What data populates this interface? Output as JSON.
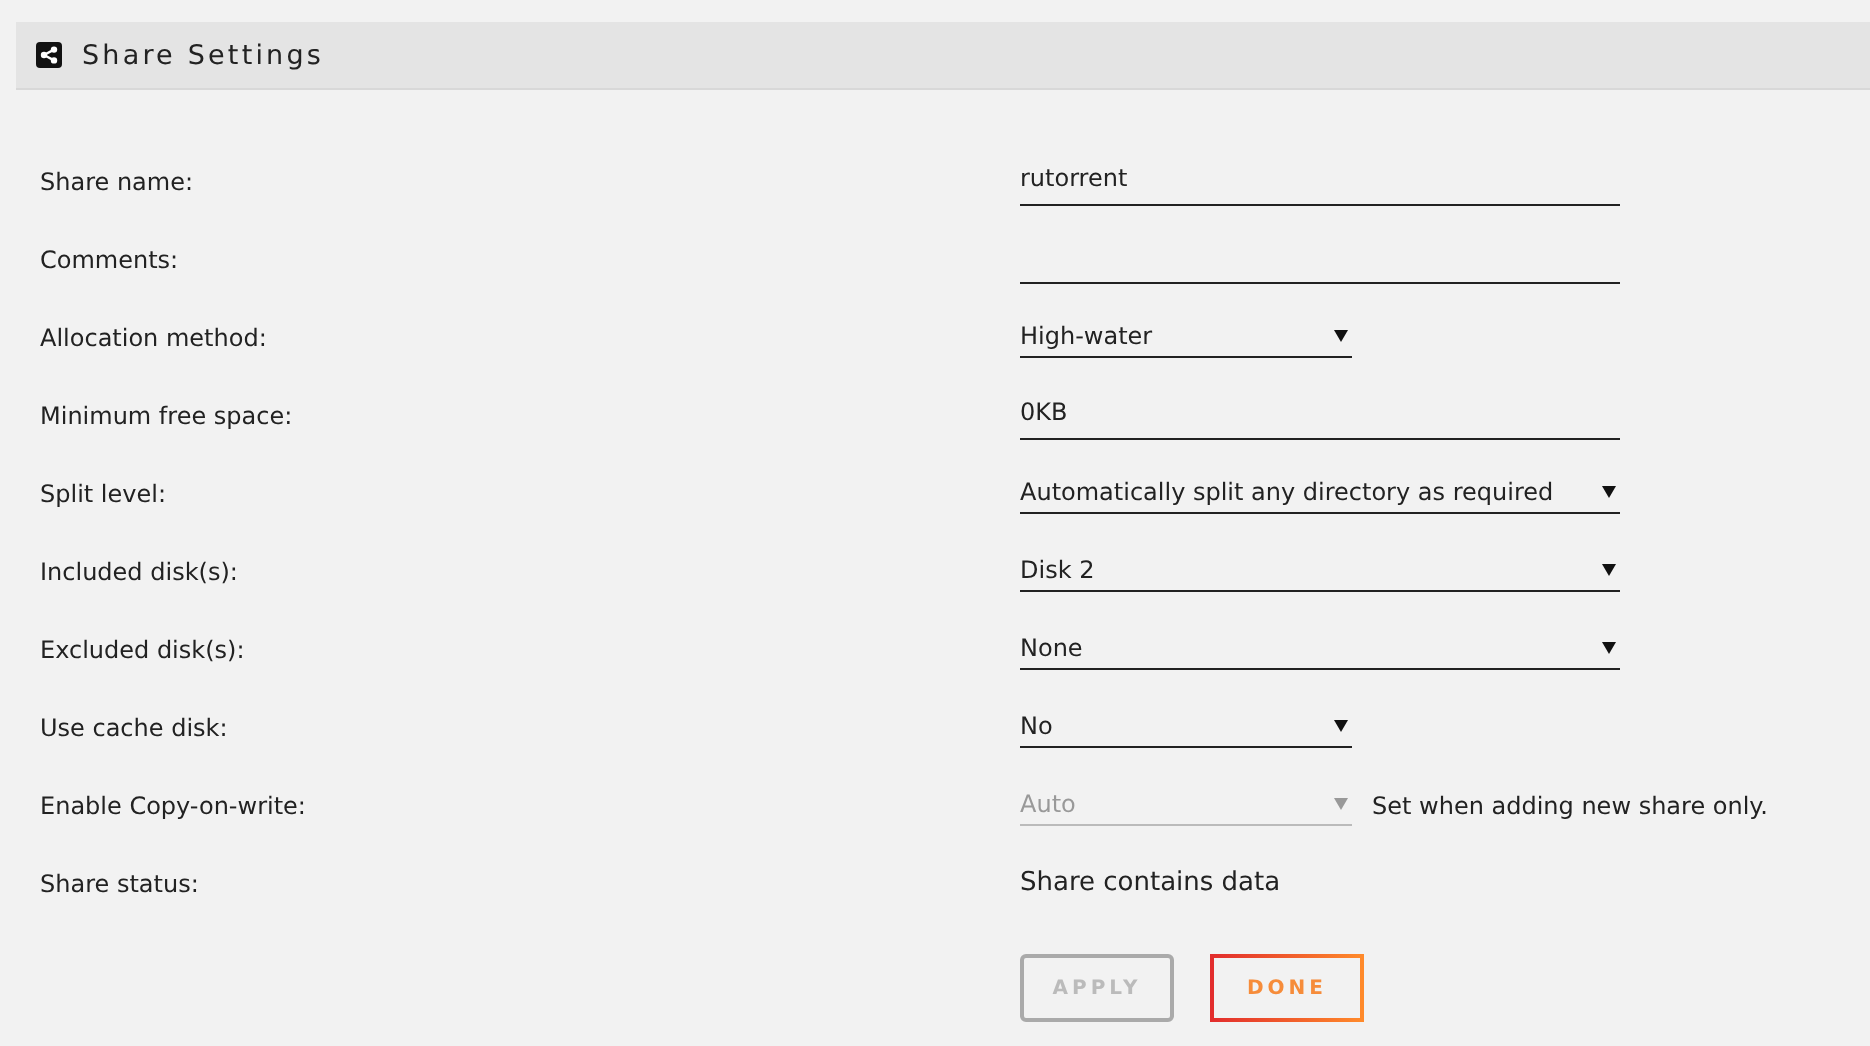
{
  "header": {
    "title": "Share Settings"
  },
  "rows": [
    {
      "label": "Share name:",
      "kind": "textbox",
      "value": "rutorrent"
    },
    {
      "label": "Comments:",
      "kind": "textbox"
    },
    {
      "label": "Allocation method:",
      "kind": "dropdown",
      "value": "High-water",
      "disabled": false
    },
    {
      "label": "Minimum free space:",
      "kind": "textbox",
      "value": "0KB"
    },
    {
      "label": "Split level:",
      "kind": "wide_dropdown",
      "value": "Automatically split any directory as required",
      "disabled": false
    },
    {
      "label": "Included disk(s):",
      "kind": "wide_dropdown",
      "value": "Disk 2",
      "disabled": false
    },
    {
      "label": "Excluded disk(s):",
      "kind": "wide_dropdown",
      "value": "None",
      "disabled": false
    },
    {
      "label": "Use cache disk:",
      "kind": "dropdown",
      "value": "No",
      "disabled": false
    },
    {
      "label": "Enable Copy-on-write:",
      "kind": "dropdown",
      "value": "Auto",
      "disabled": true,
      "note": "Set when adding new share only."
    },
    {
      "label": "Share status:",
      "kind": "status",
      "value": "Share contains data"
    }
  ],
  "buttons": [
    {
      "label": "APPLY",
      "disabled": true
    },
    {
      "label": "DONE",
      "disabled": false
    }
  ]
}
